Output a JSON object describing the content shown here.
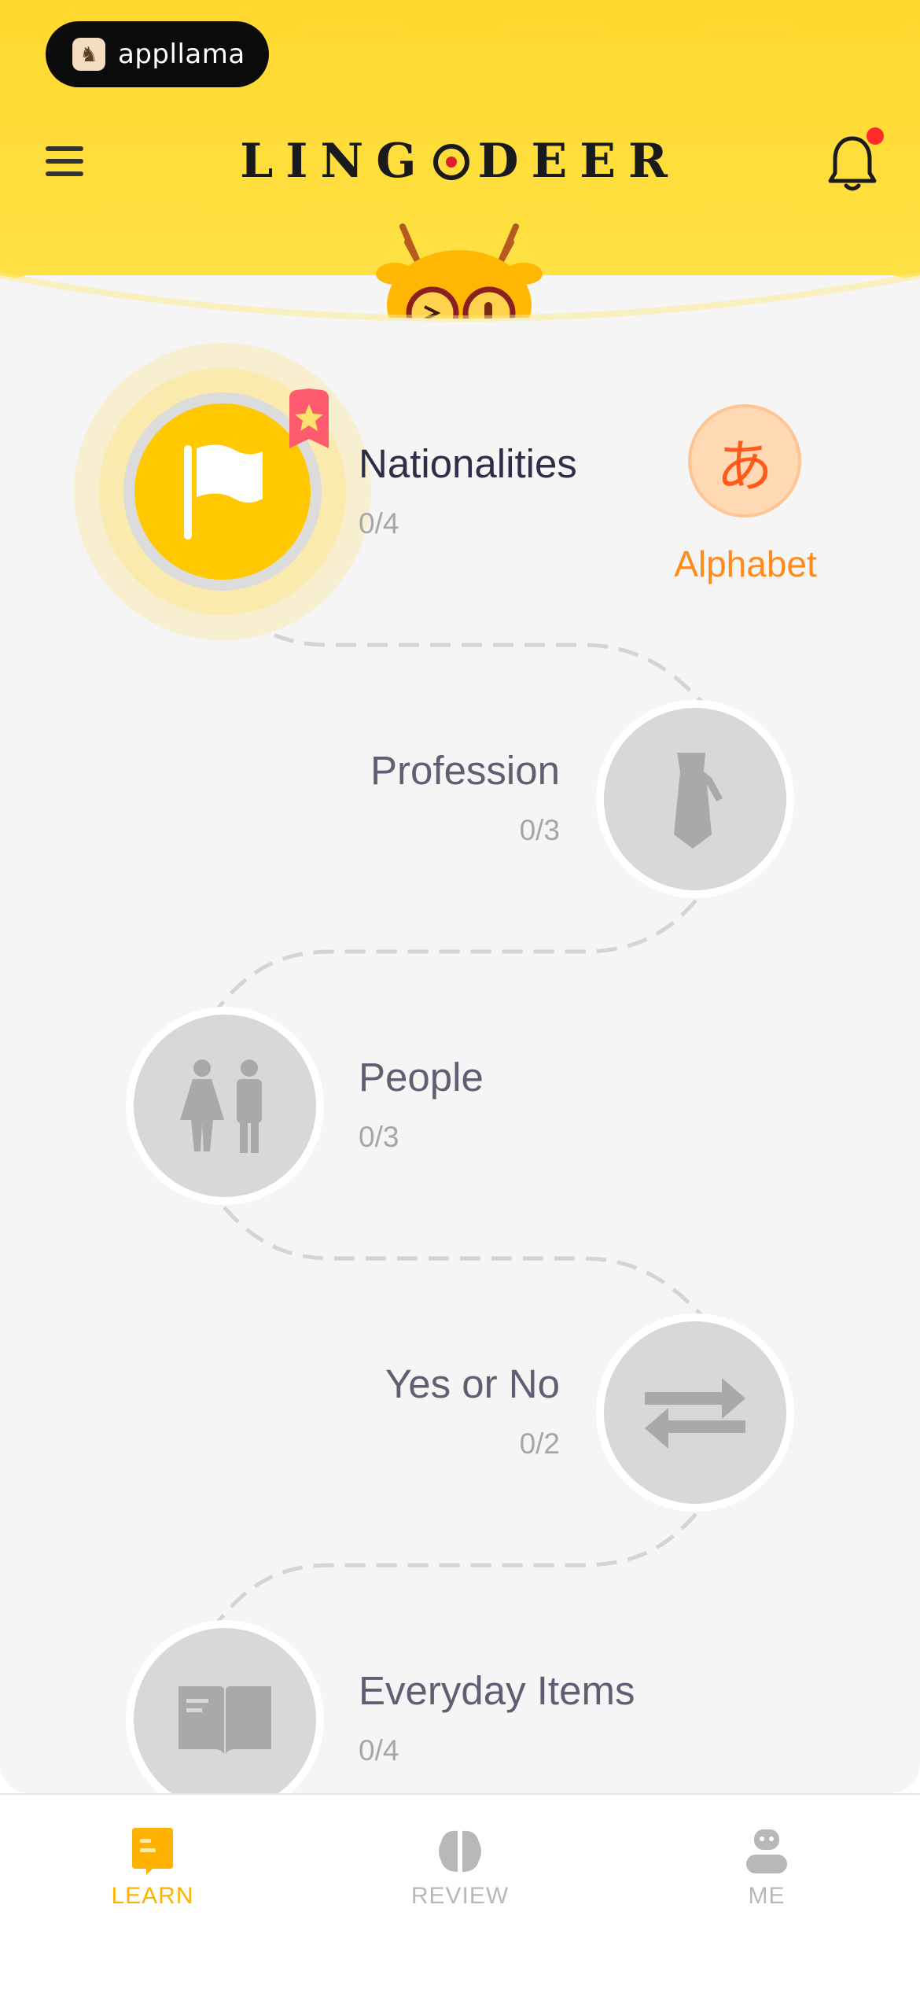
{
  "header": {
    "badge_text": "appllama",
    "logo_part1": "LING",
    "logo_part2": "DEER",
    "notification_dot_color": "#ff2a2a"
  },
  "alphabet": {
    "glyph": "あ",
    "label": "Alphabet"
  },
  "lessons": [
    {
      "title": "Nationalities",
      "progress": "0/4",
      "icon": "flag-icon",
      "status": "active"
    },
    {
      "title": "Profession",
      "progress": "0/3",
      "icon": "tie-icon",
      "status": "locked"
    },
    {
      "title": "People",
      "progress": "0/3",
      "icon": "people-icon",
      "status": "locked"
    },
    {
      "title": "Yes or No",
      "progress": "0/2",
      "icon": "swap-arrows-icon",
      "status": "locked"
    },
    {
      "title": "Everyday Items",
      "progress": "0/4",
      "icon": "book-icon",
      "status": "locked"
    }
  ],
  "tabs": [
    {
      "label": "LEARN",
      "icon": "learn-icon",
      "active": true
    },
    {
      "label": "REVIEW",
      "icon": "brain-icon",
      "active": false
    },
    {
      "label": "ME",
      "icon": "profile-icon",
      "active": false
    }
  ],
  "colors": {
    "accent": "#ffc800",
    "alphabet_accent": "#ff8a1e",
    "locked_node": "#d8d8d8"
  }
}
